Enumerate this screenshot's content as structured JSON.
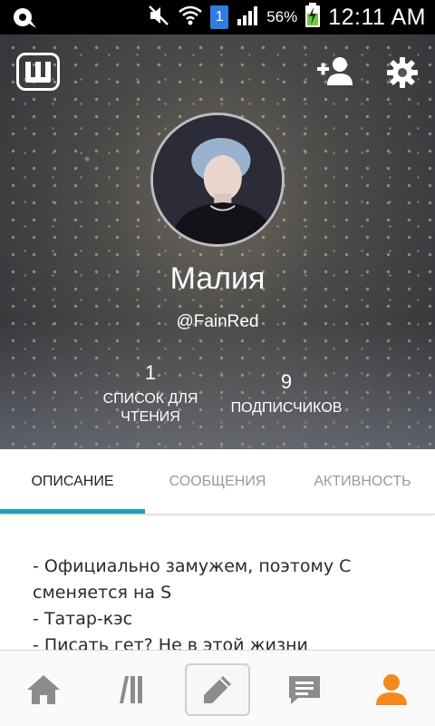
{
  "status_bar": {
    "battery_percent": "56%",
    "time": "12:11 AM",
    "sim_label": "1",
    "icons": [
      "notification-icon",
      "mute-icon",
      "wifi-icon",
      "sim-icon",
      "signal-icon",
      "battery-charging-icon"
    ]
  },
  "header": {
    "logo_icon": "wattpad-logo-icon",
    "add_friend_icon": "add-user-icon",
    "settings_icon": "gear-icon",
    "display_name": "Малия",
    "username": "@FainRed",
    "stats": {
      "reading_lists": {
        "count": "1",
        "label_line1": "СПИСОК ДЛЯ",
        "label_line2": "ЧТЕНИЯ"
      },
      "followers": {
        "count": "9",
        "label": "ПОДПИСЧИКОВ"
      }
    }
  },
  "tabs": [
    {
      "label": "ОПИСАНИЕ",
      "active": true
    },
    {
      "label": "СООБЩЕНИЯ",
      "active": false
    },
    {
      "label": "АКТИВНОСТЬ",
      "active": false
    }
  ],
  "description_lines": [
    "- Официально замужем, поэтому C",
    "сменяется на S",
    "- Татар-кэс",
    "- Писать гет? Не в этой жизни"
  ],
  "bottom_nav": {
    "items": [
      "home-icon",
      "library-icon",
      "write-icon",
      "inbox-icon",
      "profile-icon"
    ],
    "active": "profile-icon",
    "inactive_color": "#8c8c8c",
    "active_color": "#f5891e"
  },
  "colors": {
    "accent": "#1aa3b8",
    "status_bar": "#000000"
  }
}
